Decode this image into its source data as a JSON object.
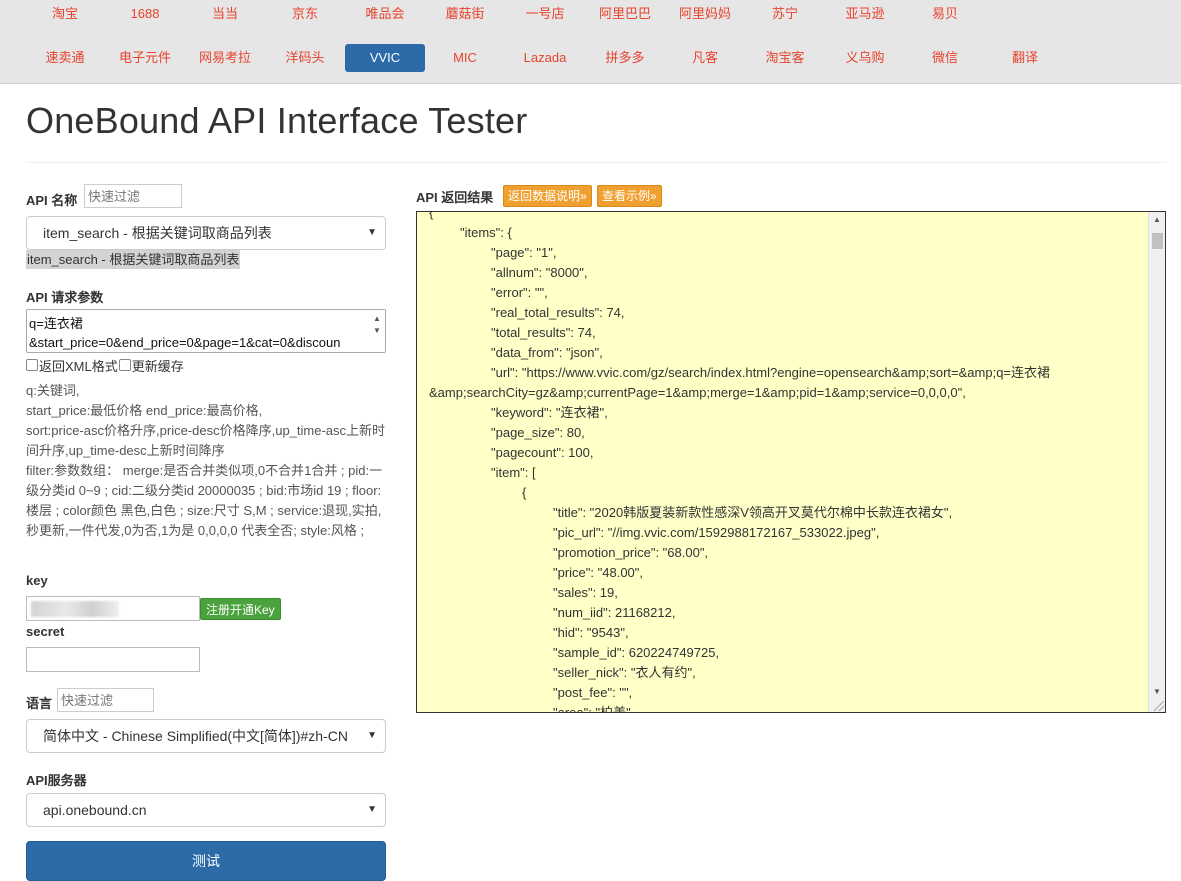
{
  "nav": {
    "row1": [
      "淘宝",
      "1688",
      "当当",
      "京东",
      "唯品会",
      "蘑菇街",
      "一号店",
      "阿里巴巴",
      "阿里妈妈",
      "苏宁",
      "亚马逊",
      "易贝"
    ],
    "row2": [
      "速卖通",
      "电子元件",
      "网易考拉",
      "洋码头",
      "VVIC",
      "MIC",
      "Lazada",
      "拼多多",
      "凡客",
      "淘宝客",
      "义乌购",
      "微信",
      "翻译"
    ],
    "active": "VVIC"
  },
  "page_title": "OneBound API Interface Tester",
  "api_name": {
    "label": "API 名称",
    "filter_placeholder": "快速过滤",
    "selected": "item_search - 根据关键词取商品列表",
    "highlight": "item_search - 根据关键词取商品列表"
  },
  "params": {
    "label": "API 请求参数",
    "line1": "q=连衣裙",
    "line2": "&start_price=0&end_price=0&page=1&cat=0&discoun",
    "checkbox_xml": "返回XML格式",
    "checkbox_cache": "更新缓存",
    "help_lines": [
      "q:关键词,",
      "start_price:最低价格 end_price:最高价格,",
      "sort:price-asc价格升序,price-desc价格降序,up_time-asc上新时间升序,up_time-desc上新时间降序",
      "filter:参数数组： merge:是否合并类似项,0不合并1合并 ; pid:一级分类id 0~9 ; cid:二级分类id 20000035 ; bid:市场id 19 ; floor:楼层 ; color颜色 黑色,白色 ; size:尺寸 S,M ; service:退现,实拍,秒更新,一件代发,0为否,1为是 0,0,0,0 代表全否; style:风格 ;"
    ]
  },
  "key": {
    "label": "key",
    "register_button": "注册开通Key"
  },
  "secret": {
    "label": "secret"
  },
  "language": {
    "label": "语言",
    "filter_placeholder": "快速过滤",
    "selected": "简体中文 - Chinese Simplified(中文[简体])#zh-CN"
  },
  "server": {
    "label": "API服务器",
    "selected": "api.onebound.cn"
  },
  "submit_label": "测试",
  "result": {
    "label": "API 返回结果",
    "btn_desc": "返回数据说明»",
    "btn_example": "查看示例»",
    "lines": [
      {
        "indent": 0,
        "text": "{"
      },
      {
        "indent": 1,
        "text": "\"items\": {"
      },
      {
        "indent": 2,
        "text": "\"page\": \"1\","
      },
      {
        "indent": 2,
        "text": "\"allnum\": \"8000\","
      },
      {
        "indent": 2,
        "text": "\"error\": \"\","
      },
      {
        "indent": 2,
        "text": "\"real_total_results\": 74,"
      },
      {
        "indent": 2,
        "text": "\"total_results\": 74,"
      },
      {
        "indent": 2,
        "text": "\"data_from\": \"json\","
      },
      {
        "indent": 2,
        "text": "\"url\": \"https://www.vvic.com/gz/search/index.html?engine=opensearch&amp;sort=&amp;q=连衣裙"
      },
      {
        "indent": 0,
        "text": "&amp;searchCity=gz&amp;currentPage=1&amp;merge=1&amp;pid=1&amp;service=0,0,0,0\","
      },
      {
        "indent": 2,
        "text": "\"keyword\": \"连衣裙\","
      },
      {
        "indent": 2,
        "text": "\"page_size\": 80,"
      },
      {
        "indent": 2,
        "text": "\"pagecount\": 100,"
      },
      {
        "indent": 2,
        "text": "\"item\": ["
      },
      {
        "indent": 3,
        "text": "{"
      },
      {
        "indent": 4,
        "text": "\"title\": \"2020韩版夏装新款性感深V领高开叉莫代尔棉中长款连衣裙女\","
      },
      {
        "indent": 4,
        "text": "\"pic_url\": \"//img.vvic.com/1592988172167_533022.jpeg\","
      },
      {
        "indent": 4,
        "text": "\"promotion_price\": \"68.00\","
      },
      {
        "indent": 4,
        "text": "\"price\": \"48.00\","
      },
      {
        "indent": 4,
        "text": "\"sales\": 19,"
      },
      {
        "indent": 4,
        "text": "\"num_iid\": 21168212,"
      },
      {
        "indent": 4,
        "text": "\"hid\": \"9543\","
      },
      {
        "indent": 4,
        "text": "\"sample_id\": 620224749725,"
      },
      {
        "indent": 4,
        "text": "\"seller_nick\": \"衣人有约\","
      },
      {
        "indent": 4,
        "text": "\"post_fee\": \"\","
      },
      {
        "indent": 4,
        "text": "\"area\": \"柏美\""
      }
    ]
  },
  "icons": {
    "caret": "▼",
    "scroll_up": "▲",
    "scroll_down": "▼"
  }
}
